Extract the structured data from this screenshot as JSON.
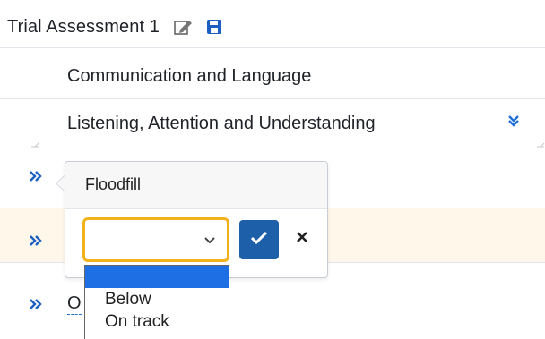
{
  "header": {
    "title": "Trial Assessment 1"
  },
  "rows": {
    "area": "Communication and Language",
    "aspect": "Listening, Attention and Understanding",
    "partial_statement": "O"
  },
  "popover": {
    "title": "Floodfill",
    "select_value": "",
    "options": [
      "",
      "Below",
      "On track"
    ]
  },
  "colors": {
    "accent": "#1e6fd9",
    "focus_border": "#f2b21b",
    "confirm_bg": "#1d5fa8",
    "selected_option": "#1e6fe3"
  },
  "icons": {
    "edit": "edit-icon",
    "save": "save-icon",
    "collapse": "chevron-double-down-icon",
    "expand": "chevron-double-right-icon",
    "confirm": "check-icon",
    "cancel": "close-icon"
  }
}
